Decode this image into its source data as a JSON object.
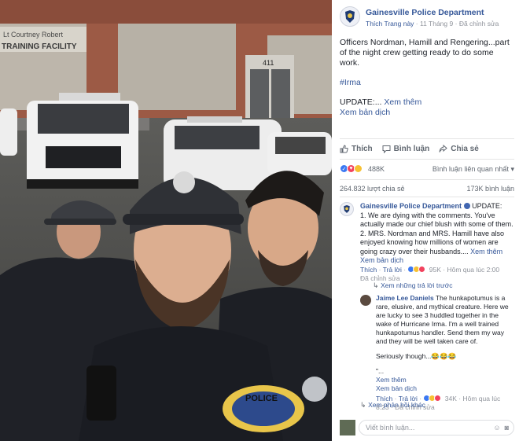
{
  "photo": {
    "sign_line1": "Lt Courtney Robert",
    "sign_line2": "TRAINING FACILITY",
    "door_number": "411",
    "patch_text": "POLICE"
  },
  "post": {
    "page_name": "Gainesville Police Department",
    "meta_like": "Thích Trang này",
    "meta_date": "11 Tháng 9",
    "meta_edited": "Đã chỉnh sửa",
    "text": "Officers Nordman, Hamill and Rengering...part of the night crew getting ready to do some work.",
    "hashtag": "#Irma",
    "update_prefix": "UPDATE:...",
    "see_more": "Xem thêm",
    "see_translation": "Xem bản dịch"
  },
  "actions": {
    "like": "Thích",
    "comment": "Bình luận",
    "share": "Chia sẻ"
  },
  "reactions": {
    "count": "488K",
    "related": "Bình luận liên quan nhất",
    "colors": {
      "like": "#3b78f2",
      "love": "#f2425e",
      "haha": "#f7c133"
    }
  },
  "stats": {
    "shares": "264.832 lượt chia sẻ",
    "comments": "173K bình luận"
  },
  "comments": [
    {
      "author": "Gainesville Police Department",
      "lead": "UPDATE:",
      "line1": "1. We are dying with the comments. You've actually made our chief blush with some of them.",
      "line2": "2. MRS. Nordman and MRS. Hamill have also enjoyed knowing how millions of women are going crazy over their husbands....",
      "see_more": "Xem thêm",
      "see_translation": "Xem bản dịch",
      "like": "Thích",
      "reply": "Trả lời",
      "reaction_count": "95K",
      "time": "Hôm qua lúc 2:00",
      "edited": "Đã chỉnh sửa"
    }
  ],
  "prev_replies": "Xem những trả lời trước",
  "reply": {
    "author": "Jaime Lee Daniels",
    "text": "The hunkapotumus is a rare, elusive, and mythical creature. Here we are lucky to see 3 huddled together in the wake of Hurricane Irma. I'm a well trained hunkapotumus handler. Send them my way and they will be well taken care of.",
    "text2": "Seriously though...",
    "text2_emoji": "😂😂😂",
    "ellipsis": "\"...",
    "see_more": "Xem thêm",
    "see_translation": "Xem bản dịch",
    "like": "Thích",
    "reply": "Trả lời",
    "reaction_count": "34K",
    "time": "Hôm qua lúc 8:23",
    "edited": "Đã chỉnh sửa"
  },
  "more_replies": "Xem phản hồi khác",
  "write": {
    "placeholder": "Viết bình luận..."
  }
}
